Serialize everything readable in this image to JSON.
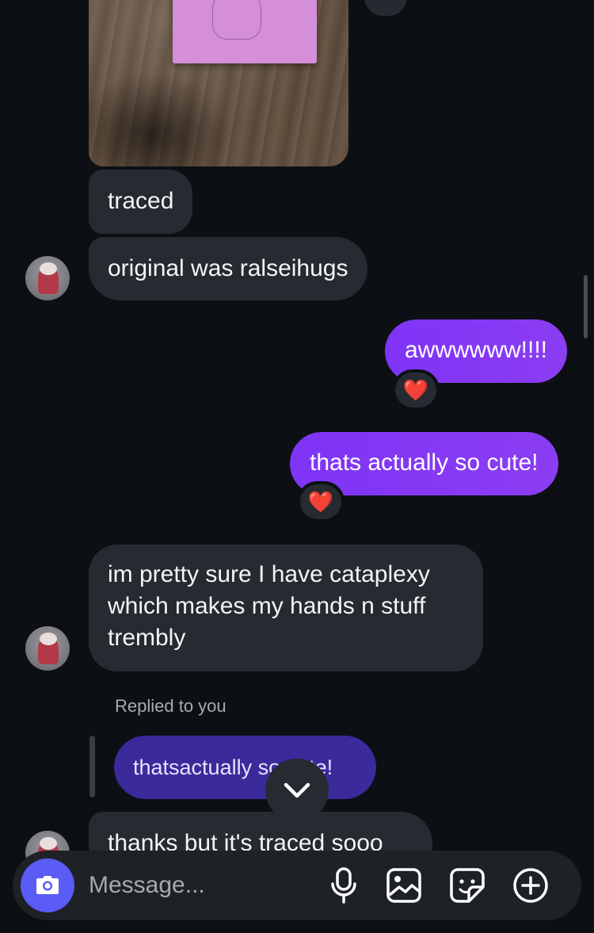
{
  "messages": {
    "traced": "traced",
    "original": "original was ralseihugs",
    "awww": "awwwwww!!!!",
    "cute": "thats actually so cute!",
    "cataplexy": "im pretty sure I have cataplexy which makes my hands n stuff trembly",
    "reply_label": "Replied to you",
    "reply_quote": "thatsactually so cute!",
    "thanks": "thanks but it's traced sooo"
  },
  "reactions": {
    "awww": "❤️",
    "cute": "❤️"
  },
  "composer": {
    "placeholder": "Message..."
  },
  "icons": [
    "camera-icon",
    "microphone-icon",
    "image-icon",
    "sticker-icon",
    "plus-icon",
    "chevron-down-icon"
  ],
  "colors": {
    "background": "#0c1014",
    "incoming_bubble": "#262a31",
    "outgoing_bubble": "#7f34f6",
    "reply_bubble": "#3b2a9a",
    "camera_button": "#5b5bf5"
  }
}
